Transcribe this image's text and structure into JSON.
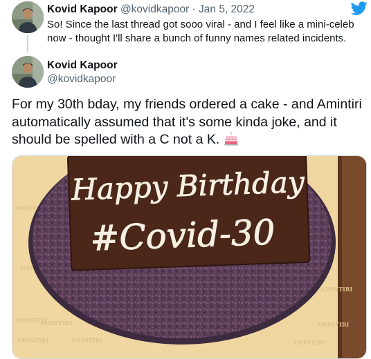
{
  "parent_tweet": {
    "author_name": "Kovid Kapoor",
    "author_handle_date": "@kovidkapoor · Jan 5, 2022",
    "text": "So! Since the last thread got sooo viral - and I feel like a mini-celeb now - thought I'll share a bunch of funny names related incidents."
  },
  "main_tweet": {
    "author_name": "Kovid Kapoor",
    "author_handle": "@kovidkapoor",
    "text": "For my 30th bday, my friends ordered a cake - and Amintiri automatically assumed that it's some kinda joke, and it should be spelled with a C not a K.",
    "emoji": "birthday-cake-emoji"
  },
  "media": {
    "cake_line1": "Happy Birthday",
    "cake_line2": "#Covid-30",
    "box_brand": "AMINTIRI",
    "colors": {
      "board": "#f0d7a2",
      "cake": "#5b3d58",
      "plaque": "#4a2719",
      "icing": "#f6f0e2"
    }
  },
  "icons": {
    "twitter": "twitter-bird-icon"
  },
  "colors": {
    "twitter_blue": "#1d9bf0",
    "secondary_text": "#536471"
  }
}
